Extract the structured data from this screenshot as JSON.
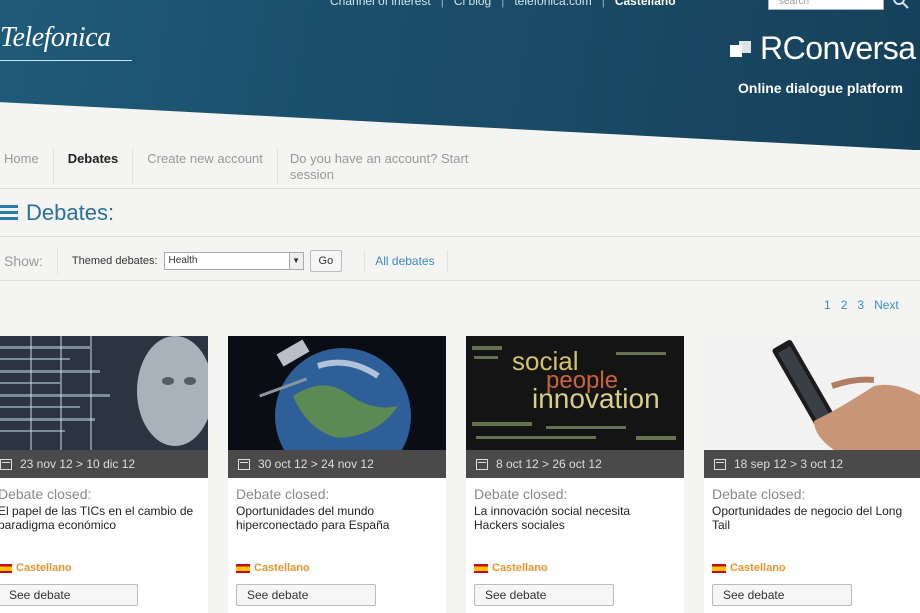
{
  "header": {
    "top_links": [
      "Channel of interest",
      "Cl blog",
      "telefonica.com"
    ],
    "lang_button": "Castellano",
    "search_placeholder": "search",
    "logo": "Telefonica",
    "brand": "RConversa",
    "tagline": "Online dialogue platform"
  },
  "nav": {
    "items": [
      "Home",
      "Debates",
      "Create new account",
      "Do you have an account? Start session"
    ]
  },
  "page": {
    "title": "Debates:"
  },
  "filter": {
    "show_label": "Show:",
    "themed_label": "Themed debates:",
    "selected": "Health",
    "go_label": "Go",
    "all_link": "All debates"
  },
  "pagination": [
    "1",
    "2",
    "3",
    "Next"
  ],
  "cards": [
    {
      "date": "23 nov 12 > 10 dic 12",
      "status": "Debate closed:",
      "title": "El papel de las TICs en el cambio de paradigma económico",
      "language": "Castellano",
      "button": "See debate"
    },
    {
      "date": "30 oct 12 > 24 nov 12",
      "status": "Debate closed:",
      "title": "Oportunidades del mundo hiperconectado para España",
      "language": "Castellano",
      "button": "See debate"
    },
    {
      "date": "8 oct 12 > 26 oct 12",
      "status": "Debate closed:",
      "title": "La innovación social necesita Hackers sociales",
      "language": "Castellano",
      "button": "See debate",
      "image_words": [
        "social",
        "people",
        "innovation"
      ]
    },
    {
      "date": "18 sep 12 > 3 oct 12",
      "status": "Debate closed:",
      "title": "Oportunidades de negocio del Long Tail",
      "language": "Castellano",
      "button": "See debate"
    }
  ],
  "colors": {
    "header": "#1b4f6c",
    "accent": "#2a6f9c",
    "link": "#3a8bc4",
    "date_bar": "#4a4a4a",
    "language": "#e59530"
  }
}
